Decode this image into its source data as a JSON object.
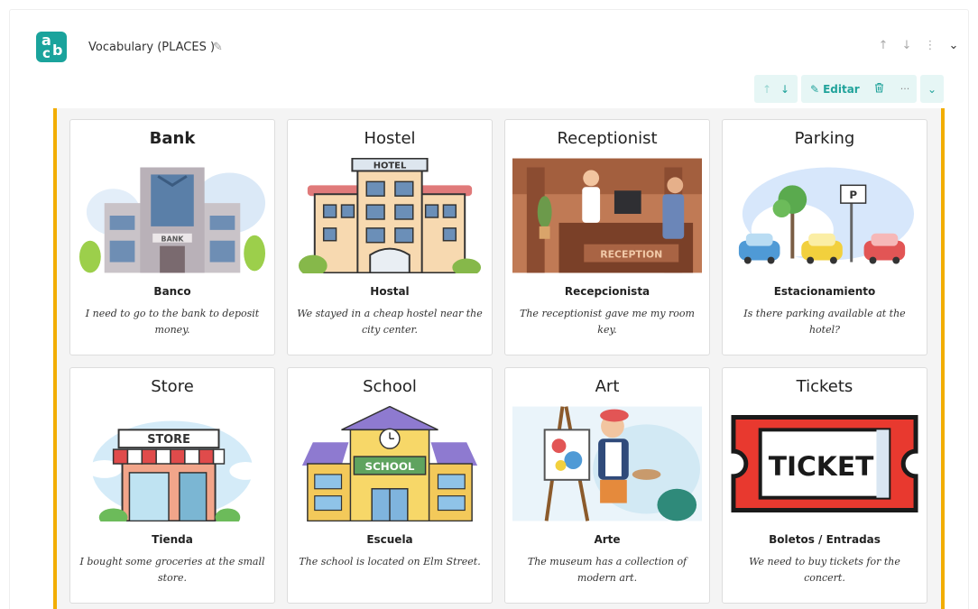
{
  "header": {
    "title": "Vocabulary (PLACES )",
    "logo_top": "a",
    "logo_bottom": "c",
    "logo_right": "b",
    "actions": [
      "arrow-up-icon",
      "arrow-down-icon",
      "kebab-icon",
      "chevron-down-icon"
    ]
  },
  "toolbar": {
    "edit_label": "Editar",
    "more_label": "···"
  },
  "colors": {
    "accent": "#21a39b",
    "border_highlight": "#f2ad00",
    "toolbar_bg": "#e6f6f5"
  },
  "cards": [
    {
      "word": "Bank",
      "translation": "Banco",
      "example": "I need to go to the bank to deposit money.",
      "image": "bank-illustration"
    },
    {
      "word": "Hostel",
      "translation": "Hostal",
      "example": "We stayed in a cheap hostel near the city center.",
      "image": "hotel-illustration",
      "sign": "HOTEL"
    },
    {
      "word": "Receptionist",
      "translation": "Recepcionista",
      "example": "The receptionist gave me my room key.",
      "image": "reception-illustration",
      "sign": "RECEPTION"
    },
    {
      "word": "Parking",
      "translation": "Estacionamiento",
      "example": "Is there parking available at the hotel?",
      "image": "parking-illustration"
    },
    {
      "word": "Store",
      "translation": "Tienda",
      "example": "I bought some groceries at the small store.",
      "image": "store-illustration",
      "sign": "STORE"
    },
    {
      "word": "School",
      "translation": "Escuela",
      "example": "The school is located on Elm Street.",
      "image": "school-illustration",
      "sign": "SCHOOL"
    },
    {
      "word": "Art",
      "translation": "Arte",
      "example": "The museum has a collection of modern art.",
      "image": "art-illustration"
    },
    {
      "word": "Tickets",
      "translation": "Boletos / Entradas",
      "example": "We need to buy tickets for the concert.",
      "image": "ticket-illustration",
      "sign": "TICKET"
    }
  ]
}
